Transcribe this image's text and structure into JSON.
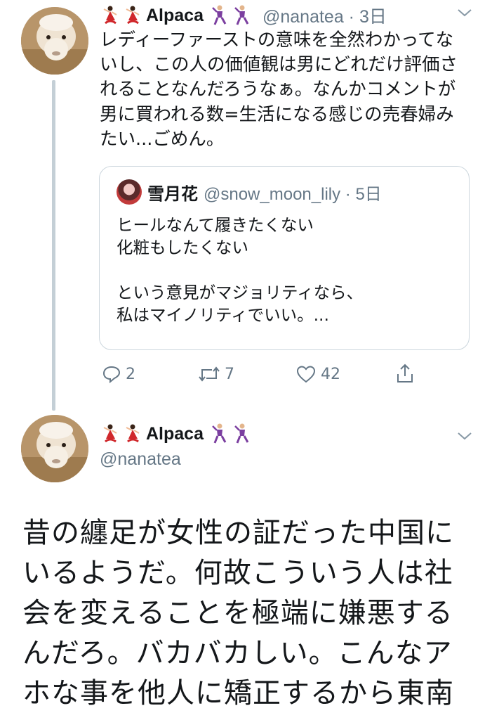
{
  "tweet1": {
    "name": "Alpaca",
    "handle_time": "@nanatea · 3日",
    "text": "レディーファーストの意味を全然わかってな\nいし、この人の価値観は男にどれだけ評価さ\nれることなんだろうなぁ。なんかコメントが\n男に買われる数=生活になる感じの売春婦み\nたい...ごめん。",
    "quote": {
      "name": "雪月花",
      "handle_time": "@snow_moon_lily · 5日",
      "text": "ヒールなんて履きたくない\n化粧もしたくない\n\nという意見がマジョリティなら、\n私はマイノリティでいい。..."
    },
    "actions": {
      "replies": "2",
      "retweets": "7",
      "likes": "42"
    }
  },
  "tweet2": {
    "name": "Alpaca",
    "handle": "@nanatea",
    "text": "昔の纏足が女性の証だった中国に\nいるようだ。何故こういう人は社\n会を変えることを極端に嫌悪する\nんだろ。バカバカしい。こんなア\nホな事を他人に矯正するから東南"
  },
  "icons": [
    "dancer-emoji-icon",
    "dancer-emoji-icon",
    "man-dancing-emoji-icon",
    "man-dancing-emoji-icon",
    "chevron-down-icon",
    "reply-icon",
    "retweet-icon",
    "like-icon",
    "share-icon"
  ],
  "colors": {
    "text": "#14171a",
    "muted": "#657786",
    "border": "#ccd6dd",
    "thread": "#c4cfd6"
  }
}
